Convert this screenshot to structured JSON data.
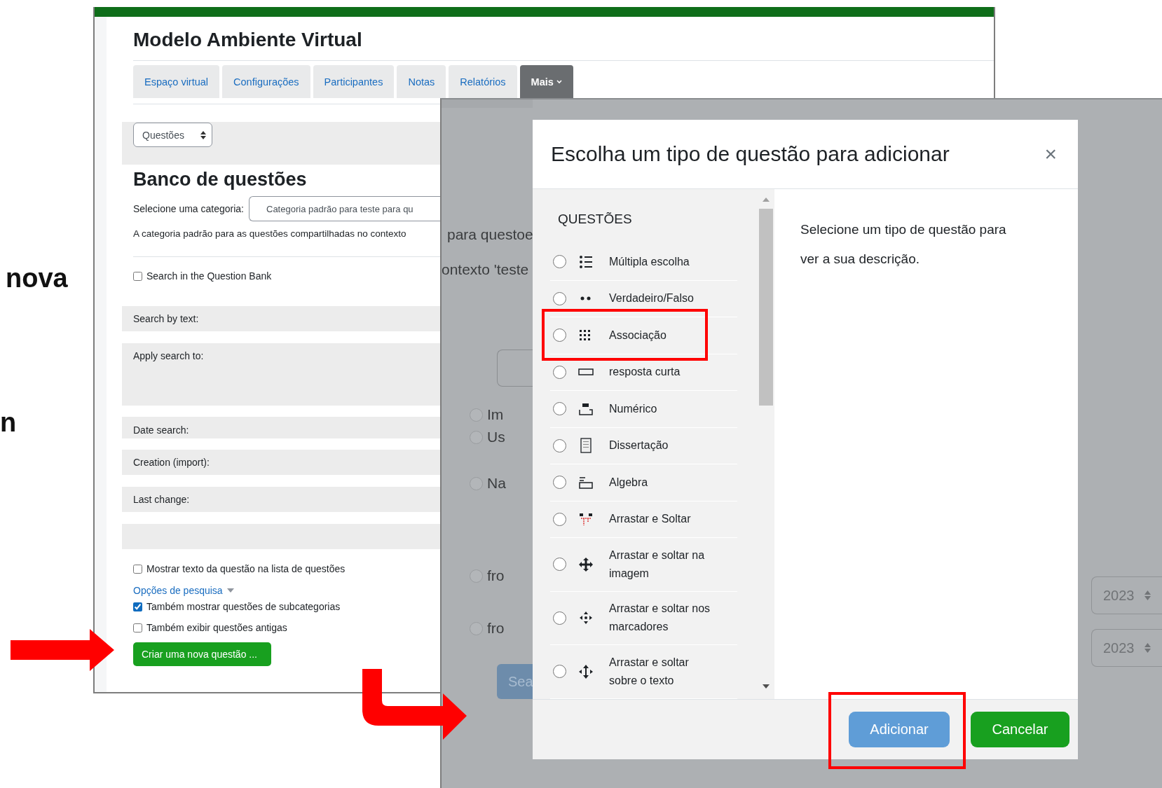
{
  "slide_fragments": [
    "nova",
    "n"
  ],
  "course_page": {
    "site_title": "Modelo Ambiente Virtual",
    "tabs": [
      {
        "label": "Espaço virtual",
        "selected": false
      },
      {
        "label": "Configurações",
        "selected": false
      },
      {
        "label": "Participantes",
        "selected": false
      },
      {
        "label": "Notas",
        "selected": false
      },
      {
        "label": "Relatórios",
        "selected": false
      },
      {
        "label": "Mais",
        "selected": true
      }
    ],
    "page_select": "Questões",
    "heading": "Banco de questões",
    "category_label": "Selecione uma categoria:",
    "category_value": "Categoria padrão para teste para qu",
    "category_note": "A categoria padrão para as questões compartilhadas no contexto",
    "search_bank": {
      "label": "Search in the Question Bank",
      "checked": false
    },
    "filters": [
      {
        "label": "Search by text:",
        "kind": "row"
      },
      {
        "label": "Apply search to:",
        "kind": "tall"
      },
      {
        "label": "Date search:",
        "kind": "short"
      },
      {
        "label": "Creation (import):",
        "kind": "row"
      },
      {
        "label": "Last change:",
        "kind": "row"
      }
    ],
    "show_text": {
      "label": "Mostrar texto da questão na lista de questões",
      "checked": false
    },
    "search_options_link": "Opções de pesquisa",
    "options": [
      {
        "label": "Também mostrar questões de subcategorias",
        "checked": true
      },
      {
        "label": "Também exibir questões antigas",
        "checked": false
      }
    ],
    "create_button": "Criar uma nova questão ..."
  },
  "back_page": {
    "cut_texts": [
      "para questoe",
      "ontexto 'teste"
    ],
    "radios_top": [
      {
        "label": "Im",
        "selected": false
      },
      {
        "label": "Us",
        "selected": false
      }
    ],
    "radio_mid": {
      "label": "Na",
      "selected": false
    },
    "from_labels": [
      {
        "label": "fro",
        "selected": false
      },
      {
        "label": "fro",
        "selected": false
      }
    ],
    "search_button": "Sea",
    "years": [
      "2023",
      "2023"
    ]
  },
  "dialog": {
    "title": "Escolha um tipo de questão para adicionar",
    "close": "×",
    "section": "QUESTÕES",
    "question_types": [
      {
        "label": "Múltipla escolha",
        "kind": "multichoice",
        "selected": false,
        "highlighted": false
      },
      {
        "label": "Verdadeiro/Falso",
        "kind": "truefalse",
        "selected": false,
        "highlighted": false
      },
      {
        "label": "Associação",
        "kind": "match",
        "selected": false,
        "highlighted": true
      },
      {
        "label": "resposta curta",
        "kind": "shortanswer",
        "selected": false,
        "highlighted": false
      },
      {
        "label": "Numérico",
        "kind": "numerical",
        "selected": false,
        "highlighted": false
      },
      {
        "label": "Dissertação",
        "kind": "essay",
        "selected": false,
        "highlighted": false
      },
      {
        "label": "Algebra",
        "kind": "algebra",
        "selected": false,
        "highlighted": false
      },
      {
        "label": "Arrastar e Soltar",
        "kind": "ddwtos",
        "selected": false,
        "highlighted": false
      },
      {
        "label": "Arrastar e soltar na imagem",
        "kind": "ddimage",
        "selected": false,
        "highlighted": false
      },
      {
        "label": "Arrastar e soltar nos marcadores",
        "kind": "ddmarker",
        "selected": false,
        "highlighted": false
      },
      {
        "label": "Arrastar e soltar sobre o texto",
        "kind": "gapselect",
        "selected": false,
        "highlighted": false
      }
    ],
    "description": "Selecione um tipo de questão para ver a sua descrição.",
    "buttons": [
      {
        "label": "Adicionar",
        "kind": "primary",
        "highlighted": true
      },
      {
        "label": "Cancelar",
        "kind": "secondary",
        "highlighted": false
      }
    ]
  }
}
